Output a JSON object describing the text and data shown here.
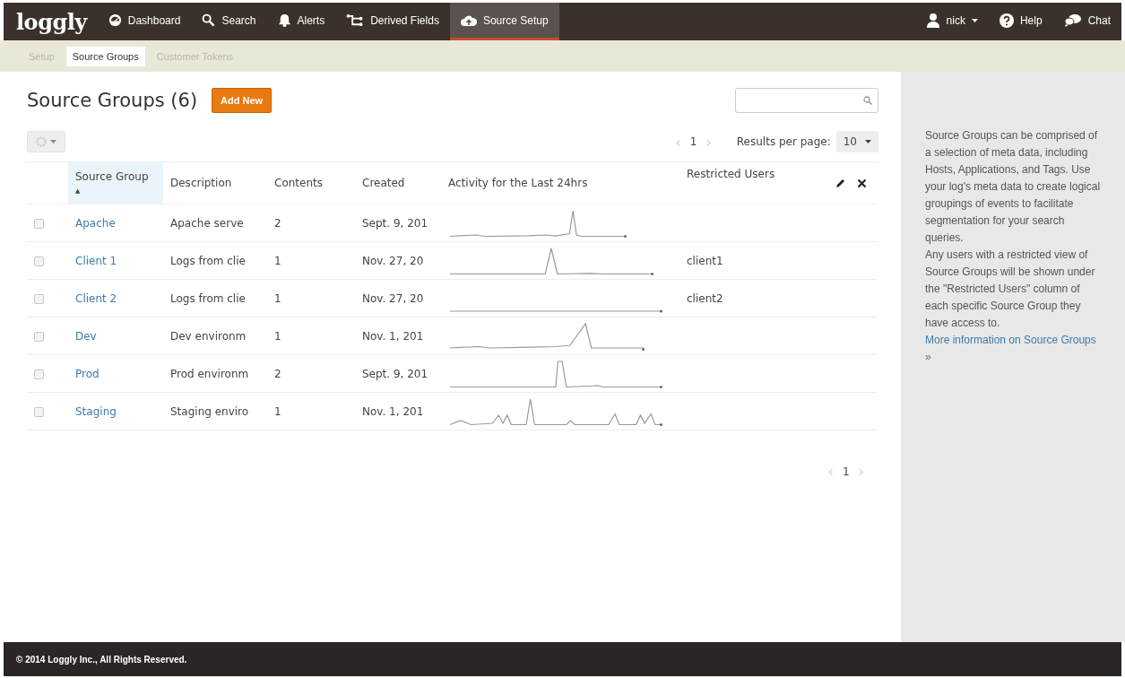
{
  "nav": {
    "logo": "loggly",
    "items": [
      {
        "label": "Dashboard",
        "selected": false
      },
      {
        "label": "Search",
        "selected": false
      },
      {
        "label": "Alerts",
        "selected": false
      },
      {
        "label": "Derived Fields",
        "selected": false
      },
      {
        "label": "Source Setup",
        "selected": true
      }
    ],
    "right": [
      {
        "label": "nick"
      },
      {
        "label": "Help"
      },
      {
        "label": "Chat"
      }
    ]
  },
  "subnav": [
    {
      "label": "Setup",
      "selected": false
    },
    {
      "label": "Source Groups",
      "selected": true
    },
    {
      "label": "Customer Tokens",
      "selected": false
    }
  ],
  "page": {
    "title": "Source Groups (6)",
    "add_button": "Add New"
  },
  "pager_top": {
    "prev": "‹",
    "page": "1",
    "next": "›",
    "per_page_label": "Results per page:",
    "per_page": "10"
  },
  "table": {
    "columns": [
      {
        "label": "Source Group",
        "sorted": true,
        "sort_indicator": "▲"
      },
      {
        "label": "Description",
        "sorted": false
      },
      {
        "label": "Contents",
        "sorted": false
      },
      {
        "label": "Created",
        "sorted": false
      },
      {
        "label": "Activity for the Last 24hrs",
        "sorted": false
      },
      {
        "label": "Restricted Users",
        "sorted": false
      }
    ],
    "rows": [
      {
        "checked": false,
        "name": "Apache",
        "description": "Apache serve",
        "contents": "2",
        "created": "Sept. 9, 201"
      },
      {
        "checked": false,
        "name": "Client 1",
        "description": "Logs from clie",
        "contents": "1",
        "created": "Nov. 27, 20",
        "restricted_users": "client1"
      },
      {
        "checked": false,
        "name": "Client 2",
        "description": "Logs from clie",
        "contents": "1",
        "created": "Nov. 27, 20",
        "restricted_users": "client2"
      },
      {
        "checked": false,
        "name": "Dev",
        "description": "Dev environm",
        "contents": "1",
        "created": "Nov. 1, 201"
      },
      {
        "checked": false,
        "name": "Prod",
        "description": "Prod environm",
        "contents": "2",
        "created": "Sept. 9, 201"
      },
      {
        "checked": false,
        "name": "Staging",
        "description": "Staging enviro",
        "contents": "1",
        "created": "Nov. 1, 201"
      }
    ]
  },
  "pager_bottom": {
    "prev": "‹",
    "page": "1",
    "next": "›"
  },
  "sidebar": {
    "paragraphs": [
      "Source Groups can be comprised of a selection of meta data, including Hosts, Applications, and Tags. Use your log's meta data to create logical groupings of events to facilitate segmentation for your search queries.",
      "Any users with a restricted view of Source Groups will be shown under the \"Restricted Users\" column of each specific Source Group they have access to."
    ],
    "link": "More information on Source Groups »"
  },
  "footer": "© 2014 Loggly Inc., All Rights Reserved."
}
